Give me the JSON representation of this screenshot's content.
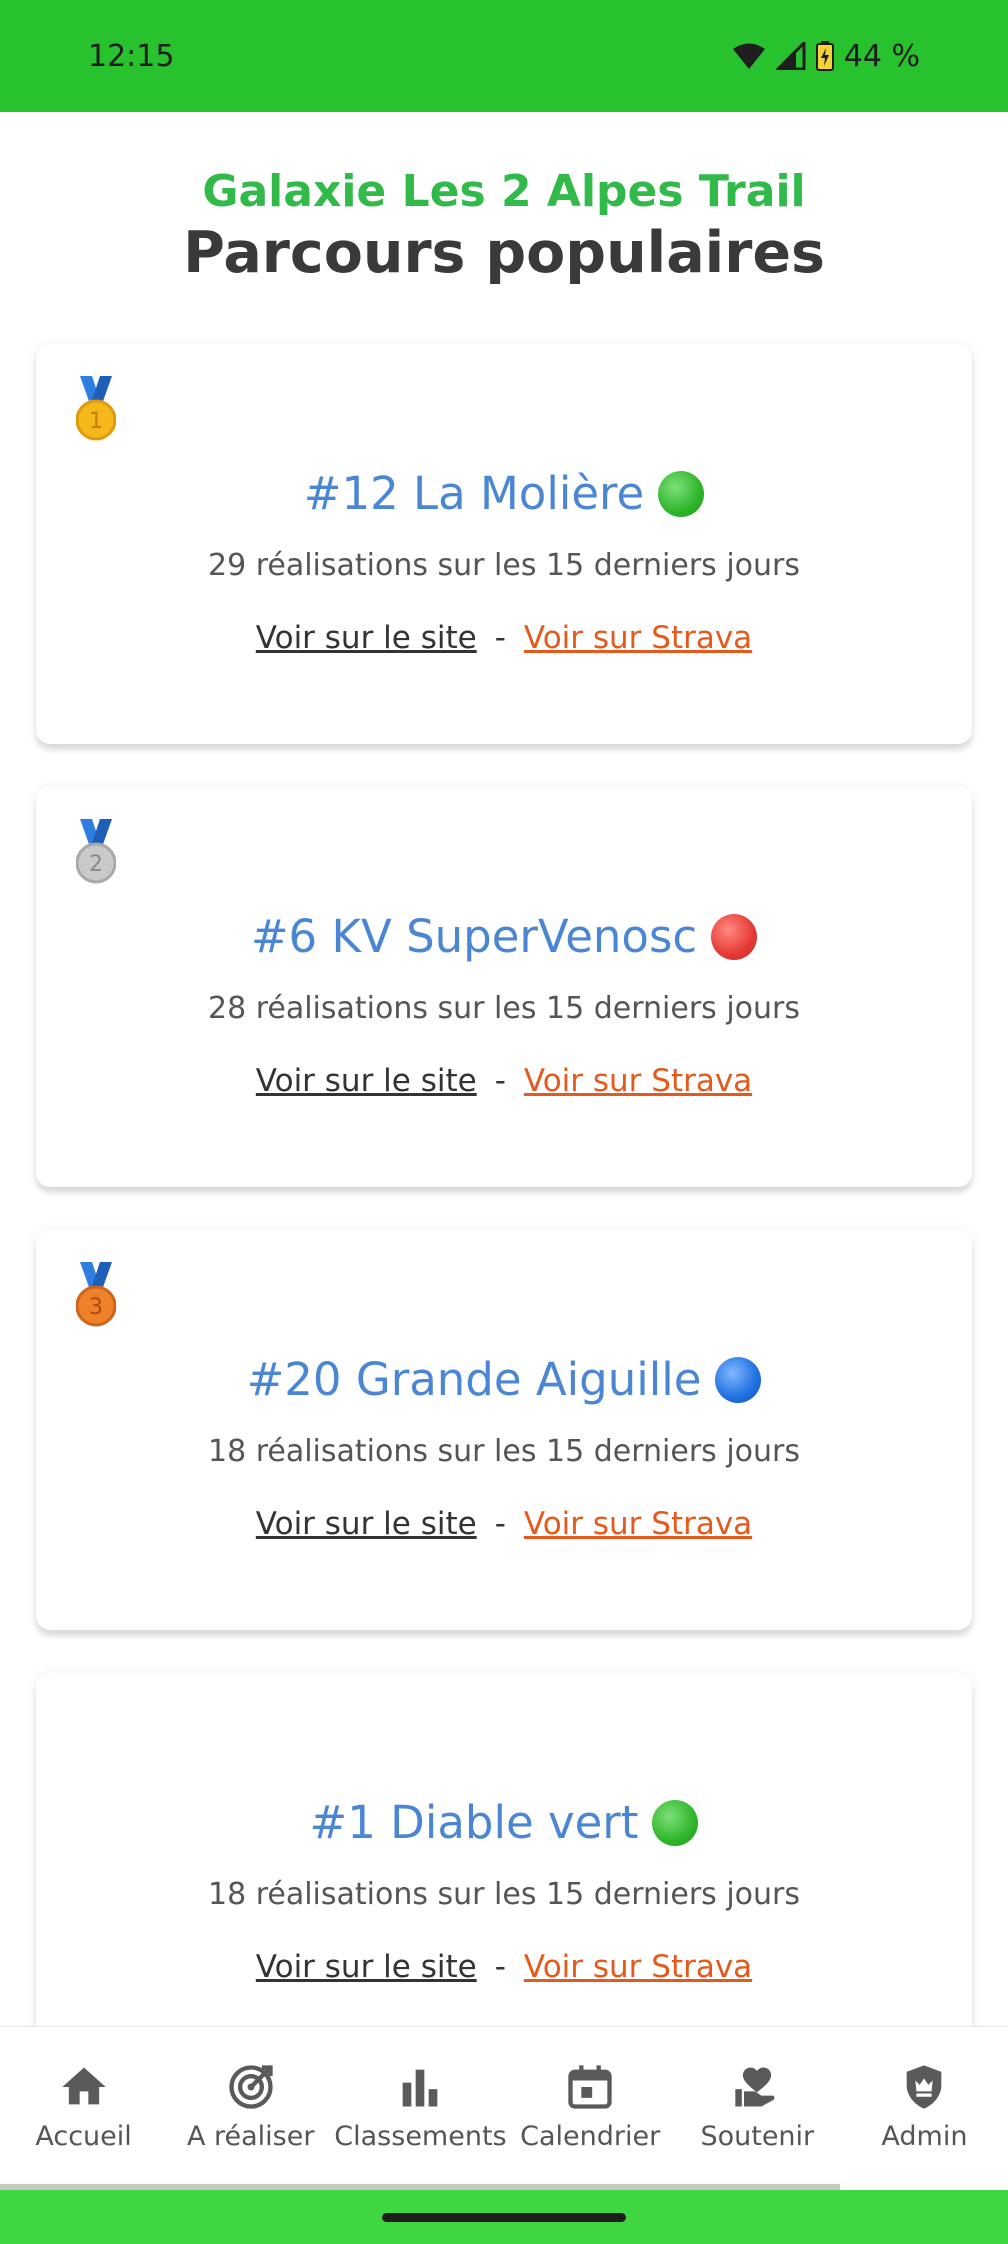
{
  "status_bar": {
    "time": "12:15",
    "battery": "44 %",
    "icons": [
      "wifi-icon",
      "signal-icon",
      "battery-icon"
    ]
  },
  "header": {
    "subtitle": "Galaxie Les 2 Alpes Trail",
    "title": "Parcours populaires"
  },
  "routes": [
    {
      "medal": "gold",
      "name": "#12 La Molière",
      "difficulty": "green",
      "stats": "29 réalisations sur les 15 derniers jours",
      "link_site": "Voir sur le site",
      "separator": "-",
      "link_strava": "Voir sur Strava"
    },
    {
      "medal": "silver",
      "name": "#6 KV SuperVenosc",
      "difficulty": "red",
      "stats": "28 réalisations sur les 15 derniers jours",
      "link_site": "Voir sur le site",
      "separator": "-",
      "link_strava": "Voir sur Strava"
    },
    {
      "medal": "bronze",
      "name": "#20 Grande Aiguille",
      "difficulty": "blue",
      "stats": "18 réalisations sur les 15 derniers jours",
      "link_site": "Voir sur le site",
      "separator": "-",
      "link_strava": "Voir sur Strava"
    },
    {
      "medal": "",
      "name": "#1 Diable vert",
      "difficulty": "green",
      "stats": "18 réalisations sur les 15 derniers jours",
      "link_site": "Voir sur le site",
      "separator": "-",
      "link_strava": "Voir sur Strava"
    }
  ],
  "nav": {
    "items": [
      {
        "label": "Accueil",
        "icon": "home-icon"
      },
      {
        "label": "A réaliser",
        "icon": "target-icon"
      },
      {
        "label": "Classements",
        "icon": "bar-chart-icon"
      },
      {
        "label": "Calendrier",
        "icon": "calendar-icon"
      },
      {
        "label": "Soutenir",
        "icon": "heart-hand-icon"
      },
      {
        "label": "Admin",
        "icon": "shield-crown-icon"
      }
    ]
  },
  "colors": {
    "status_bar": "#27c22e",
    "subtitle": "#31b94a",
    "route_name": "#4a86d4",
    "strava_link": "#e55a1c",
    "gesture_bar": "#3fd63f"
  }
}
